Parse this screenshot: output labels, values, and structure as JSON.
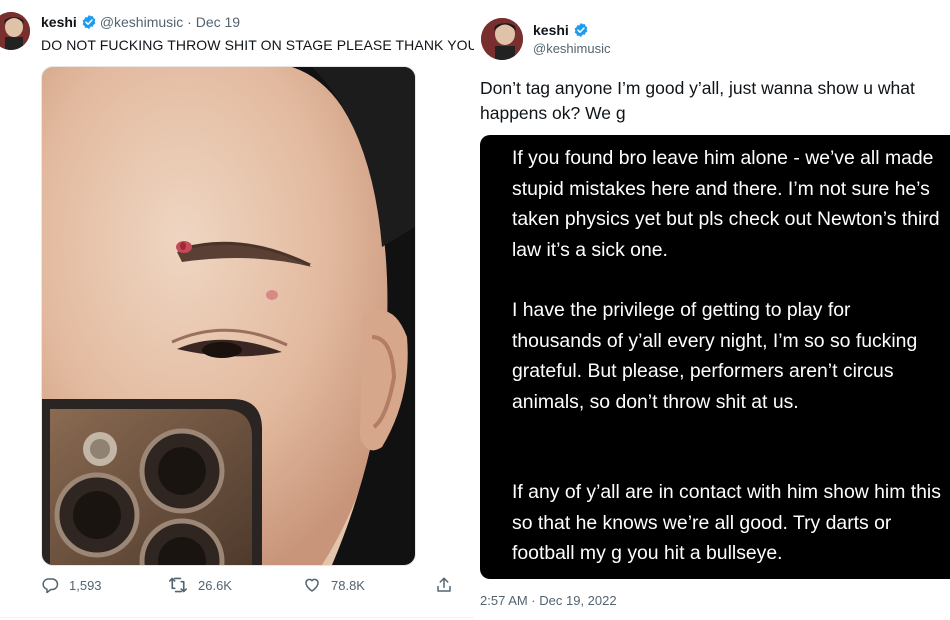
{
  "left_tweet": {
    "author_name": "keshi",
    "author_handle": "@keshimusic",
    "separator": "·",
    "date": "Dec 19",
    "text": "DO NOT FUCKING THROW SHIT ON STAGE PLEASE THANK YOU 🙏",
    "actions": {
      "replies": "1,593",
      "retweets": "26.6K",
      "likes": "78.8K"
    }
  },
  "right_tweet": {
    "author_name": "keshi",
    "author_handle": "@keshimusic",
    "text": "Don’t tag anyone I’m good y’all, just wanna show u what happens ok? We g",
    "note_paragraphs": [
      "If you found bro leave him alone - we’ve all made stupid mistakes here and there. I’m not sure he’s taken physics yet but pls check out Newton’s third law it’s a sick one.",
      "I have the privilege of getting to play for thousands of y’all every night, I’m so so fucking grateful. But please, performers aren’t circus animals, so don’t throw shit at us.",
      "If any of y’all are in contact with him show him this so that he knows we’re all good. Try darts or football my g you hit a bullseye."
    ],
    "timestamp": "2:57 AM · Dec 19, 2022"
  },
  "colors": {
    "verified_blue": "#1d9bf0",
    "secondary_text": "#536471",
    "primary_text": "#0f1419",
    "note_background": "#000000"
  },
  "icons": [
    "verified-badge-icon",
    "reply-icon",
    "retweet-icon",
    "like-icon",
    "share-icon"
  ]
}
